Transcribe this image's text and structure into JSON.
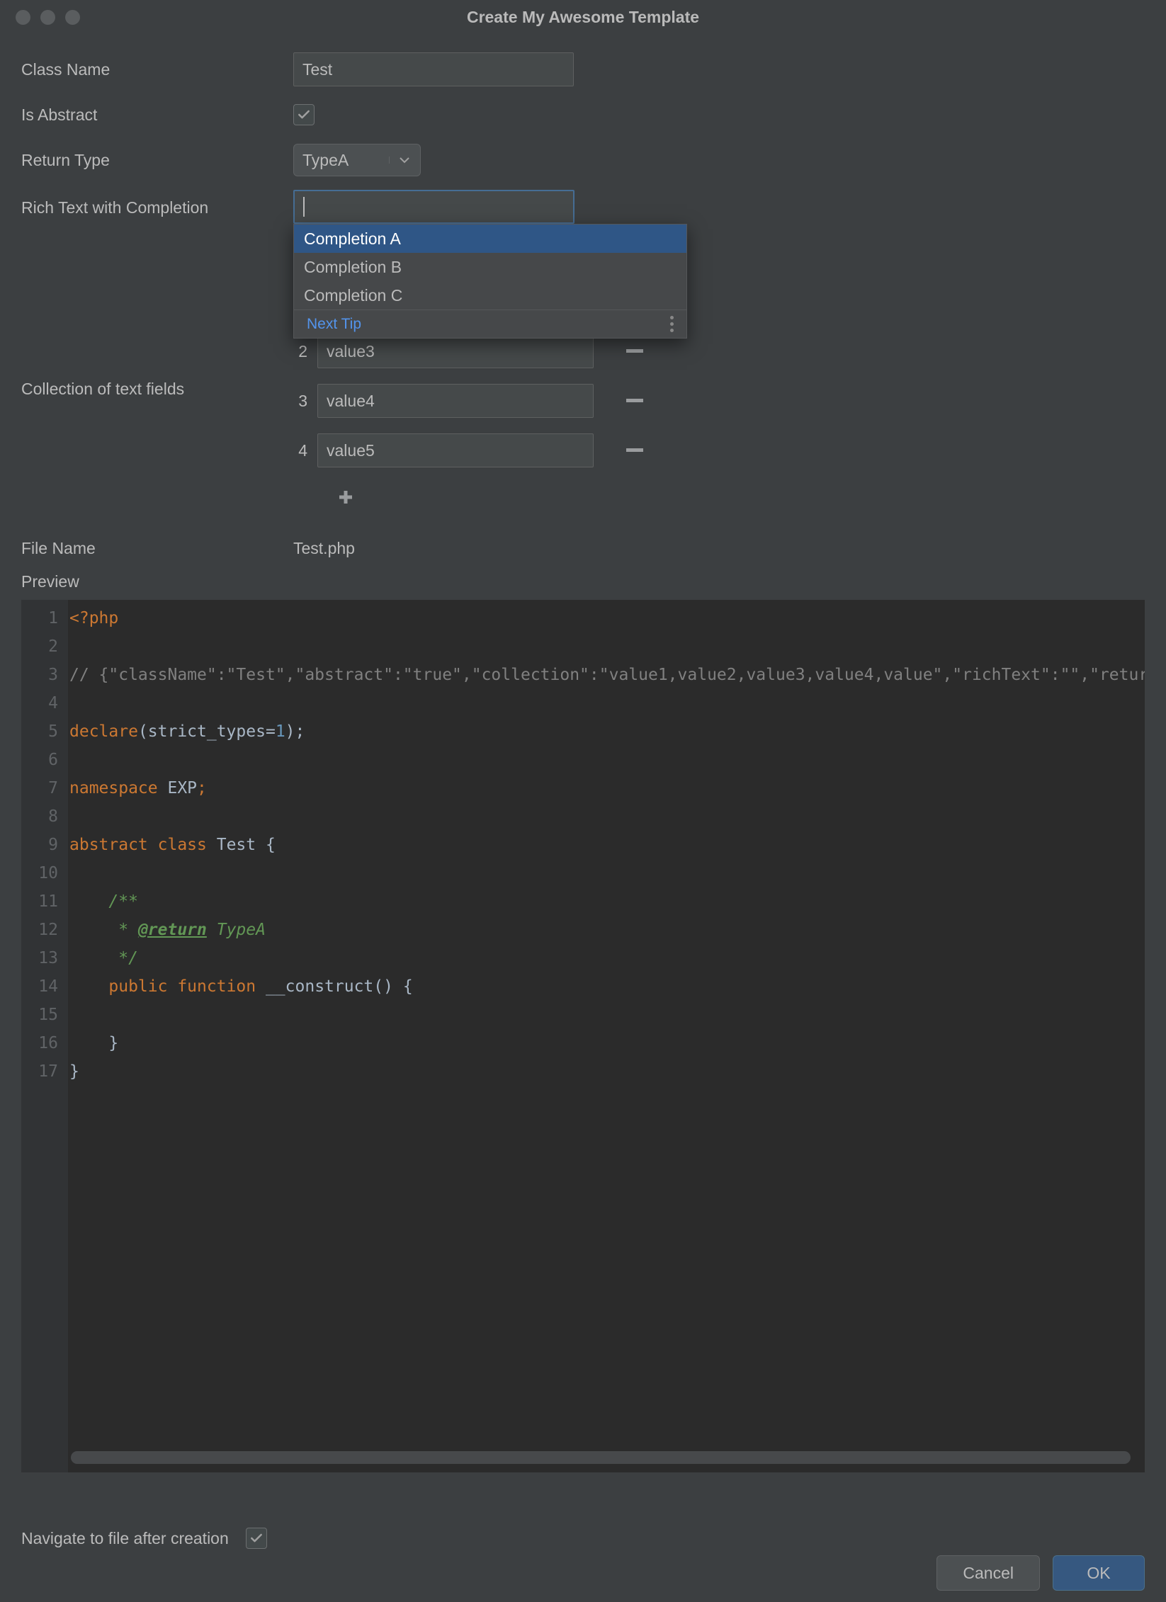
{
  "title": "Create My Awesome Template",
  "labels": {
    "className": "Class Name",
    "isAbstract": "Is Abstract",
    "returnType": "Return Type",
    "richText": "Rich Text with Completion",
    "collection": "Collection of text fields",
    "fileName": "File Name",
    "preview": "Preview",
    "navigate": "Navigate to file after creation"
  },
  "fields": {
    "className": "Test",
    "isAbstract": true,
    "returnType": "TypeA",
    "richText": "",
    "navigateAfter": true,
    "fileName": "Test.php"
  },
  "completion": {
    "items": [
      "Completion A",
      "Completion B",
      "Completion C"
    ],
    "selectedIndex": 0,
    "footer": "Next Tip"
  },
  "collection": [
    {
      "index": "2",
      "value": "value3"
    },
    {
      "index": "3",
      "value": "value4"
    },
    {
      "index": "4",
      "value": "value5"
    }
  ],
  "buttons": {
    "cancel": "Cancel",
    "ok": "OK"
  },
  "code": {
    "lines": 17,
    "l1_a": "<?php",
    "l3_a": "// {\"className\":\"Test\",\"abstract\":\"true\",\"collection\":\"value1,value2,value3,value4,value\",\"richText\":\"\",\"returnType\":\"TypeA\"",
    "l5_declare": "declare",
    "l5_paren": "(strict_types=",
    "l5_one": "1",
    "l5_end": ");",
    "l7_ns": "namespace ",
    "l7_exp": "EXP",
    "l7_semi": ";",
    "l9_ac": "abstract class ",
    "l9_test": "Test {",
    "l11": "    /**",
    "l12_a": "     * ",
    "l12_ret": "@return",
    "l12_b": " TypeA",
    "l13": "     */",
    "l14_pub": "    public ",
    "l14_func": "function ",
    "l14_name": "__construct",
    "l14_end": "() {",
    "l16": "    }",
    "l17": "}"
  }
}
